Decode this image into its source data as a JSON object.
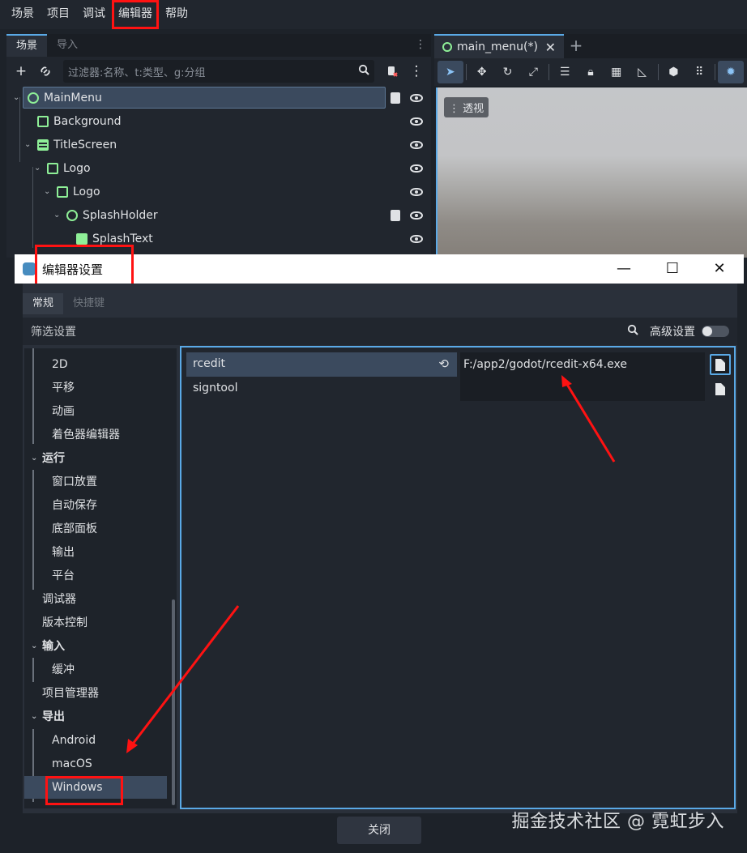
{
  "menubar": {
    "items": [
      "场景",
      "项目",
      "调试",
      "编辑器",
      "帮助"
    ]
  },
  "scene_dock": {
    "tabs": [
      "场景",
      "导入"
    ],
    "filter_placeholder": "过滤器:名称、t:类型、g:分组",
    "nodes": [
      {
        "label": "MainMenu",
        "icon": "control-node-icon"
      },
      {
        "label": "Background",
        "icon": "texture-rect-icon"
      },
      {
        "label": "TitleScreen",
        "icon": "vbox-icon"
      },
      {
        "label": "Logo",
        "icon": "center-container-icon"
      },
      {
        "label": "Logo",
        "icon": "texture-rect-icon"
      },
      {
        "label": "SplashHolder",
        "icon": "control-node-icon"
      },
      {
        "label": "SplashText",
        "icon": "label-icon"
      }
    ]
  },
  "viewport": {
    "tab_label": "main_menu(*)",
    "perspective_label": "透视"
  },
  "dialog": {
    "title": "编辑器设置",
    "tabs": [
      "常规",
      "快捷键"
    ],
    "filter_placeholder": "筛选设置",
    "advanced_label": "高级设置",
    "sections": [
      {
        "label": "2D",
        "level": 2
      },
      {
        "label": "平移",
        "level": 2
      },
      {
        "label": "动画",
        "level": 2
      },
      {
        "label": "着色器编辑器",
        "level": 2
      },
      {
        "label": "运行",
        "level": 0
      },
      {
        "label": "窗口放置",
        "level": 2
      },
      {
        "label": "自动保存",
        "level": 2
      },
      {
        "label": "底部面板",
        "level": 2
      },
      {
        "label": "输出",
        "level": 2
      },
      {
        "label": "平台",
        "level": 2
      },
      {
        "label": "调试器",
        "level": 1
      },
      {
        "label": "版本控制",
        "level": 1
      },
      {
        "label": "输入",
        "level": 0
      },
      {
        "label": "缓冲",
        "level": 2
      },
      {
        "label": "项目管理器",
        "level": 1
      },
      {
        "label": "导出",
        "level": 0
      },
      {
        "label": "Android",
        "level": 2
      },
      {
        "label": "macOS",
        "level": 2
      },
      {
        "label": "Windows",
        "level": 2
      }
    ],
    "properties": [
      {
        "name": "rcedit",
        "value": "F:/app2/godot/rcedit-x64.exe"
      },
      {
        "name": "signtool",
        "value": ""
      }
    ],
    "close_label": "关闭"
  },
  "watermark": "掘金技术社区 @ 霓虹步入",
  "colors": {
    "accent": "#5aa9e6",
    "highlight": "#ff1212",
    "node_green": "#8eef97"
  }
}
